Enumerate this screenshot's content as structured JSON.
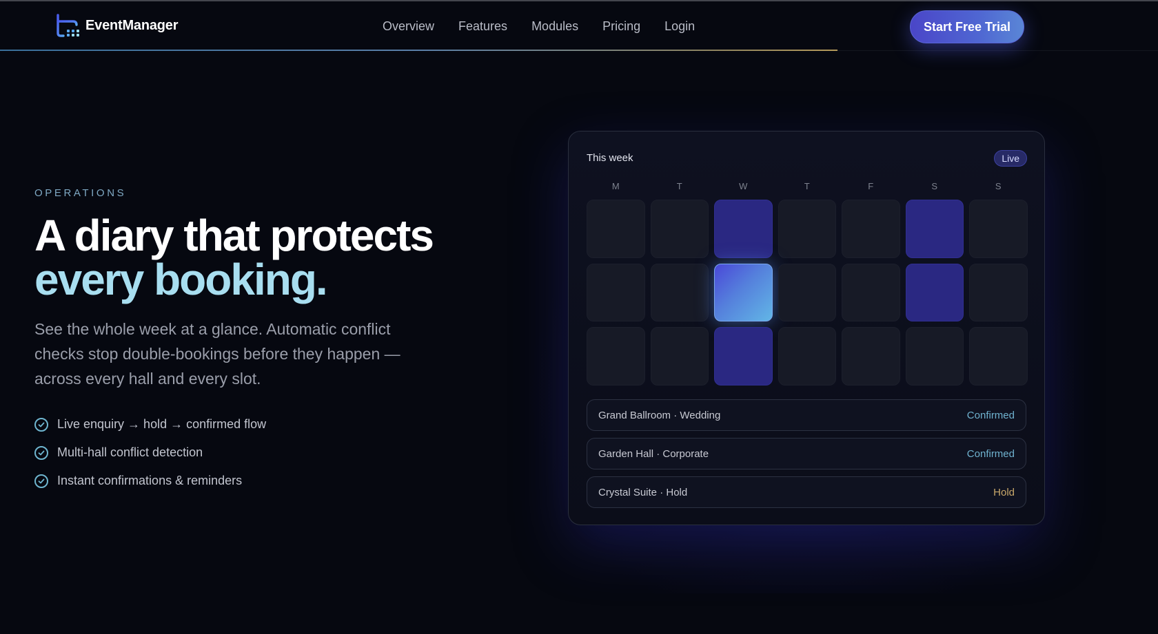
{
  "nav": {
    "brand": "EventManager",
    "links": [
      "Overview",
      "Features",
      "Modules",
      "Pricing",
      "Login"
    ],
    "cta_label": "Start Free Trial"
  },
  "hero": {
    "eyebrow": "OPERATIONS",
    "headline_line1": "A diary that protects",
    "headline_line2": "every booking.",
    "lead": "See the whole week at a glance. Automatic conflict checks stop double-bookings before they happen — across every hall and every slot.",
    "features": [
      "Live enquiry → hold → confirmed flow",
      "Multi-hall conflict detection",
      "Instant confirmations & reminders"
    ]
  },
  "calendar": {
    "title": "This week",
    "badge": "Live",
    "days": [
      "M",
      "T",
      "W",
      "T",
      "F",
      "S",
      "S"
    ],
    "grid_states": [
      [
        "empty",
        "empty",
        "booked",
        "empty",
        "empty",
        "booked",
        "empty"
      ],
      [
        "empty",
        "empty",
        "active",
        "empty",
        "empty",
        "booked",
        "empty"
      ],
      [
        "empty",
        "empty",
        "booked",
        "empty",
        "empty",
        "empty",
        "empty"
      ]
    ],
    "bookings": [
      {
        "title": "Grand Ballroom · Wedding",
        "status": "Confirmed",
        "status_type": "confirmed"
      },
      {
        "title": "Garden Hall · Corporate",
        "status": "Confirmed",
        "status_type": "confirmed"
      },
      {
        "title": "Crystal Suite · Hold",
        "status": "Hold",
        "status_type": "hold"
      }
    ]
  },
  "colors": {
    "background": "#060810",
    "accent": "#4f66d2",
    "headline_highlight": "#a8def0",
    "confirmed": "#6fb2cf",
    "hold": "#c9a86a"
  }
}
